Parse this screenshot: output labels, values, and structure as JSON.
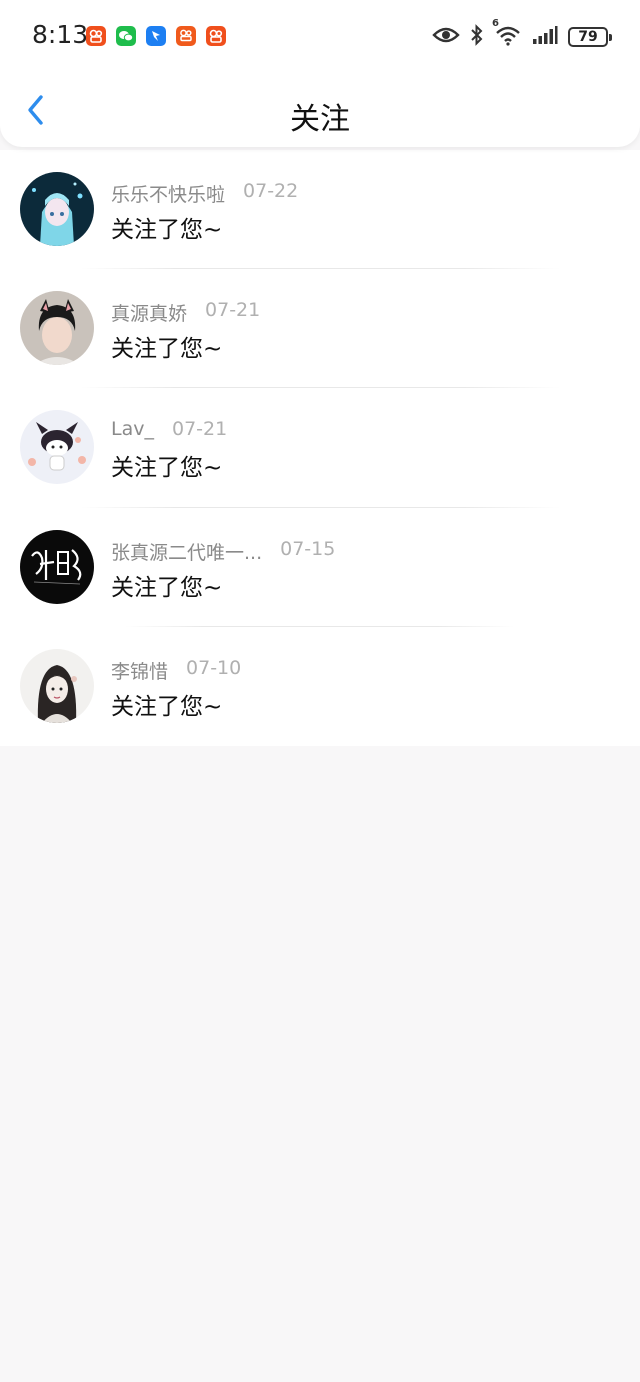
{
  "status_bar": {
    "time": "8:13",
    "battery": "79",
    "network_label": "6"
  },
  "nav": {
    "title": "关注"
  },
  "notifications": [
    {
      "name": "乐乐不快乐啦",
      "date": "07-22",
      "message": "关注了您~"
    },
    {
      "name": "真源真娇",
      "date": "07-21",
      "message": "关注了您~"
    },
    {
      "name": "Lav_",
      "date": "07-21",
      "message": "关注了您~"
    },
    {
      "name": "张真源二代唯一...",
      "date": "07-15",
      "message": "关注了您~"
    },
    {
      "name": "李锦惜",
      "date": "07-10",
      "message": "关注了您~"
    }
  ],
  "colors": {
    "accent": "#2e8ded",
    "background": "#f8f7f8"
  }
}
